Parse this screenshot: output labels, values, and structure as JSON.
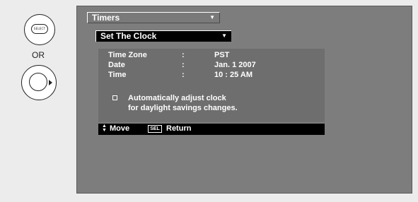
{
  "remote": {
    "select_button_label": "SELECT",
    "or_label": "OR"
  },
  "menu": {
    "timers_label": "Timers",
    "set_clock_label": "Set The Clock",
    "caret": "▼"
  },
  "settings": {
    "time_zone": {
      "label": "Time Zone",
      "separator": ":",
      "value": "PST"
    },
    "date": {
      "label": "Date",
      "separator": ":",
      "value": "Jan. 1 2007"
    },
    "time": {
      "label": "Time",
      "separator": ":",
      "value": "10 : 25 AM"
    }
  },
  "auto_adjust": {
    "line1": "Automatically adjust clock",
    "line2": "for daylight savings changes.",
    "checked": false
  },
  "footer": {
    "move_label": "Move",
    "sel_key": "SEL",
    "return_label": "Return"
  }
}
